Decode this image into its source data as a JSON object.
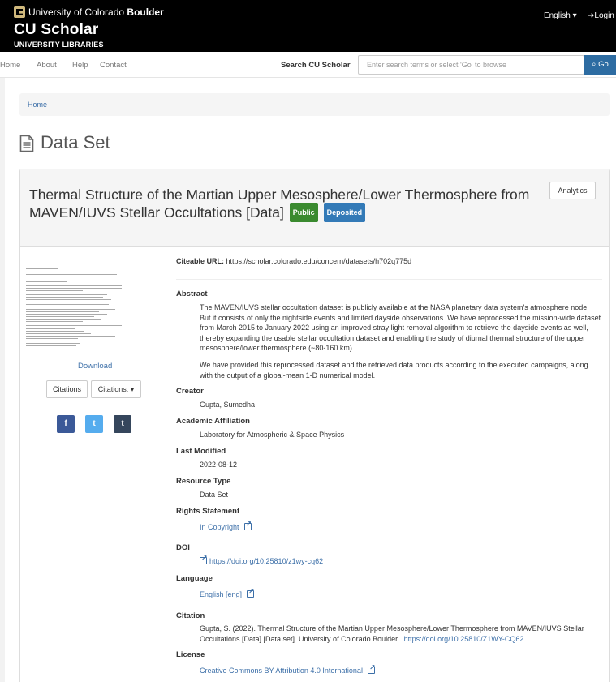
{
  "header": {
    "university_prefix": "University of Colorado",
    "university_bold": "Boulder",
    "site_title": "CU Scholar",
    "site_subtitle": "UNIVERSITY LIBRARIES",
    "language": "English ▾",
    "login": "Login"
  },
  "nav": {
    "items": [
      "Home",
      "About",
      "Help",
      "Contact"
    ],
    "search_label": "Search CU Scholar",
    "search_placeholder": "Enter search terms or select 'Go' to browse",
    "go_label": "Go"
  },
  "breadcrumb": {
    "home": "Home"
  },
  "page": {
    "title": "Data Set"
  },
  "work": {
    "title": "Thermal Structure of the Martian Upper Mesosphere/Lower Thermosphere from MAVEN/IUVS Stellar Occultations [Data]",
    "badge_public": "Public",
    "badge_deposited": "Deposited",
    "analytics_label": "Analytics"
  },
  "sidebar": {
    "download_label": "Download",
    "citations_label": "Citations",
    "citations_dropdown_label": "Citations: ▾",
    "social": [
      {
        "icon": "facebook-icon",
        "glyph": "f",
        "color": "#3b5998"
      },
      {
        "icon": "twitter-icon",
        "glyph": "t",
        "color": "#55acee"
      },
      {
        "icon": "tumblr-icon",
        "glyph": "t",
        "color": "#35465c"
      }
    ]
  },
  "details": {
    "citeable_label": "Citeable URL:",
    "citeable_url": "https://scholar.colorado.edu/concern/datasets/h702q775d",
    "abstract_label": "Abstract",
    "abstract_p1": "The MAVEN/IUVS stellar occultation dataset is publicly available at the NASA planetary data system's atmosphere node. But it consists of only the nightside events and limited dayside observations. We have reprocessed the mission-wide dataset from March 2015 to January 2022 using an improved stray light removal algorithm to retrieve the dayside events as well, thereby expanding the usable stellar occultation dataset and enabling the study of diurnal thermal structure of the upper mesosphere/lower thermosphere (~80-160 km).",
    "abstract_p2": "We have provided this reprocessed dataset and the retrieved data products according to the executed campaigns, along with the output of a global-mean 1-D numerical model.",
    "creator_label": "Creator",
    "creator": "Gupta, Sumedha",
    "affiliation_label": "Academic Affiliation",
    "affiliation": "Laboratory for Atmospheric & Space Physics",
    "modified_label": "Last Modified",
    "modified": "2022-08-12",
    "resource_label": "Resource Type",
    "resource": "Data Set",
    "rights_label": "Rights Statement",
    "rights": "In Copyright",
    "doi_label": "DOI",
    "doi": "https://doi.org/10.25810/z1wy-cq62",
    "language_label": "Language",
    "language": "English [eng]",
    "citation_label": "Citation",
    "citation_text": "Gupta, S. (2022). Thermal Structure of the Martian Upper Mesosphere/Lower Thermosphere from MAVEN/IUVS Stellar Occultations [Data] [Data set]. University of Colorado Boulder .",
    "citation_link": "https://doi.org/10.25810/Z1WY-CQ62",
    "license_label": "License",
    "license": "Creative Commons BY Attribution 4.0 International"
  }
}
